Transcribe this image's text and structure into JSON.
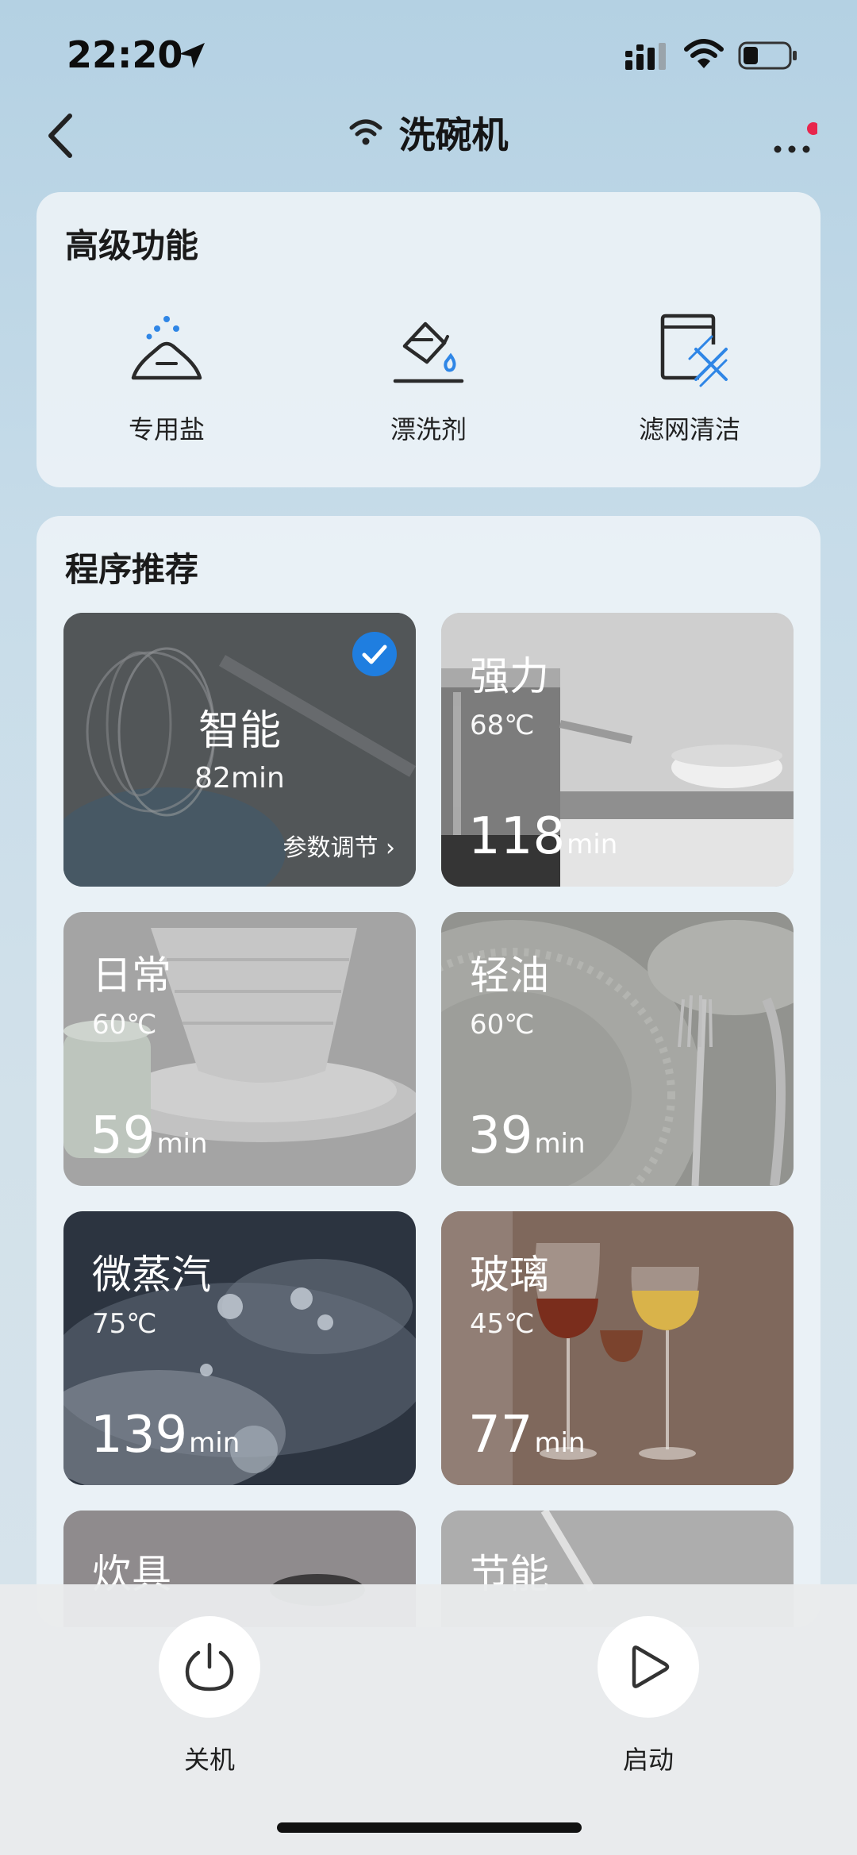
{
  "status_bar": {
    "time": "22:20"
  },
  "nav": {
    "title": "洗碗机"
  },
  "advanced": {
    "title": "高级功能",
    "items": [
      {
        "label": "专用盐",
        "icon": "salt-icon"
      },
      {
        "label": "漂洗剂",
        "icon": "rinse-aid-icon"
      },
      {
        "label": "滤网清洁",
        "icon": "filter-clean-icon"
      }
    ]
  },
  "programs": {
    "title": "程序推荐",
    "items": [
      {
        "name": "智能",
        "duration": "82min",
        "action": "参数调节 ›",
        "selected": true
      },
      {
        "name": "强力",
        "temp": "68℃",
        "duration": "118",
        "unit": "min"
      },
      {
        "name": "日常",
        "temp": "60℃",
        "duration": "59",
        "unit": "min"
      },
      {
        "name": "轻油",
        "temp": "60℃",
        "duration": "39",
        "unit": "min"
      },
      {
        "name": "微蒸汽",
        "temp": "75℃",
        "duration": "139",
        "unit": "min"
      },
      {
        "name": "玻璃",
        "temp": "45℃",
        "duration": "77",
        "unit": "min"
      },
      {
        "name": "炊具"
      },
      {
        "name": "节能"
      }
    ]
  },
  "controls": {
    "power_label": "关机",
    "start_label": "启动"
  },
  "colors": {
    "accent": "#1f7ee0",
    "notification_dot": "#e8264d"
  }
}
